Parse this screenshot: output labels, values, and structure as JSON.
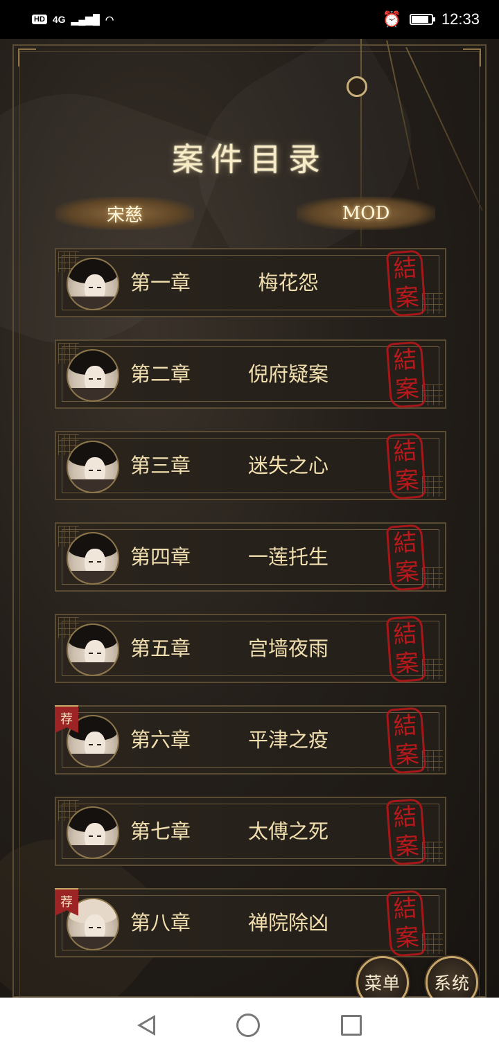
{
  "status_bar": {
    "hd": "HD",
    "network": "4G",
    "time": "12:33",
    "battery_level": 0.85
  },
  "title": "案件目录",
  "tabs": [
    "宋慈",
    "MOD"
  ],
  "chapters": [
    {
      "num": "第一章",
      "name": "梅花怨",
      "seal": [
        "結",
        "案"
      ],
      "ribbon": ""
    },
    {
      "num": "第二章",
      "name": "倪府疑案",
      "seal": [
        "結",
        "案"
      ],
      "ribbon": ""
    },
    {
      "num": "第三章",
      "name": "迷失之心",
      "seal": [
        "結",
        "案"
      ],
      "ribbon": ""
    },
    {
      "num": "第四章",
      "name": "一莲托生",
      "seal": [
        "結",
        "案"
      ],
      "ribbon": ""
    },
    {
      "num": "第五章",
      "name": "宫墙夜雨",
      "seal": [
        "結",
        "案"
      ],
      "ribbon": ""
    },
    {
      "num": "第六章",
      "name": "平津之疫",
      "seal": [
        "結",
        "案"
      ],
      "ribbon": "荐"
    },
    {
      "num": "第七章",
      "name": "太傅之死",
      "seal": [
        "結",
        "案"
      ],
      "ribbon": ""
    },
    {
      "num": "第八章",
      "name": "禅院除凶",
      "seal": [
        "結",
        "案"
      ],
      "ribbon": "荐"
    }
  ],
  "buttons": {
    "menu": "菜单",
    "system": "系统"
  },
  "colors": {
    "gold_text": "#f2dfb0",
    "seal_red": "#c4191d",
    "frame_gold": "#8a7448"
  }
}
